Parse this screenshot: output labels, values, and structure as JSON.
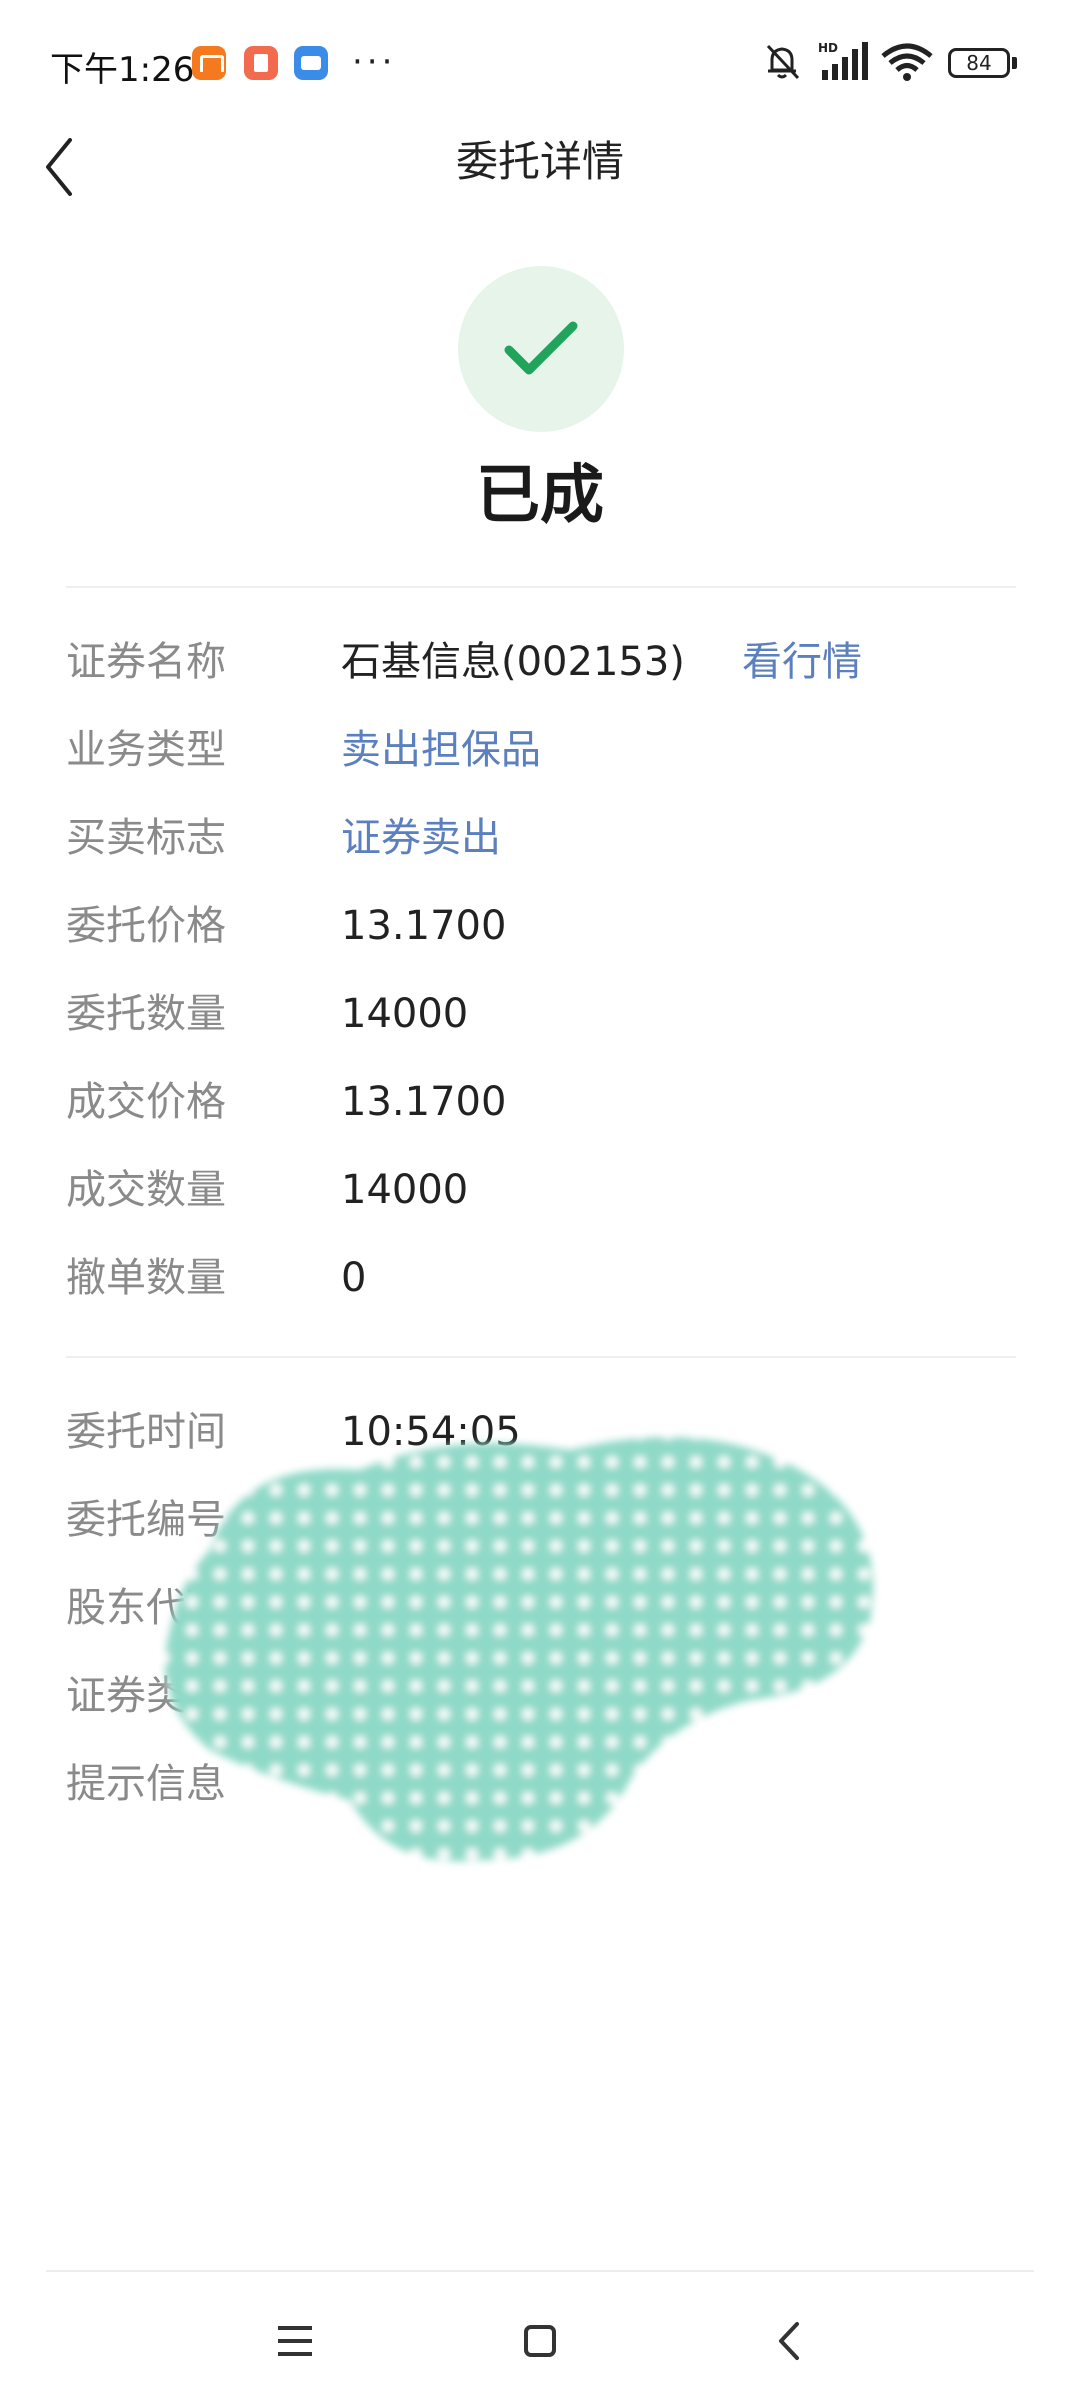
{
  "status_bar": {
    "time": "下午1:26",
    "more": "···",
    "battery": "84",
    "icons": [
      "mi-app-icon",
      "delete-app-icon",
      "wallet-app-icon",
      "mute-bell-icon",
      "hd-signal-icon",
      "wifi-icon",
      "battery-icon"
    ]
  },
  "header": {
    "title": "委托详情",
    "back_icon": "chevron-left-icon"
  },
  "status": {
    "text": "已成",
    "icon": "checkmark-icon",
    "icon_color": "#20a35a",
    "circle_color": "#e6f4ea"
  },
  "details": [
    {
      "label": "证券名称",
      "value": "石基信息(002153)",
      "link": "看行情"
    },
    {
      "label": "业务类型",
      "value": "卖出担保品",
      "is_link": true
    },
    {
      "label": "买卖标志",
      "value": "证券卖出",
      "is_link": true
    },
    {
      "label": "委托价格",
      "value": "13.1700"
    },
    {
      "label": "委托数量",
      "value": "14000"
    },
    {
      "label": "成交价格",
      "value": "13.1700"
    },
    {
      "label": "成交数量",
      "value": "14000"
    },
    {
      "label": "撤单数量",
      "value": "0"
    }
  ],
  "details2": [
    {
      "label": "委托时间",
      "value": "10:54:05"
    },
    {
      "label": "委托编号",
      "value": ""
    },
    {
      "label": "股东代码",
      "value": ""
    },
    {
      "label": "证券类别",
      "value": ""
    },
    {
      "label": "提示信息",
      "value": ""
    }
  ],
  "colors": {
    "link": "#5b7fbf",
    "label": "#8a8a8a",
    "redaction": "#8fd9c8"
  },
  "nav": {
    "icons": [
      "menu-icon",
      "home-square-icon",
      "back-chevron-icon"
    ]
  }
}
